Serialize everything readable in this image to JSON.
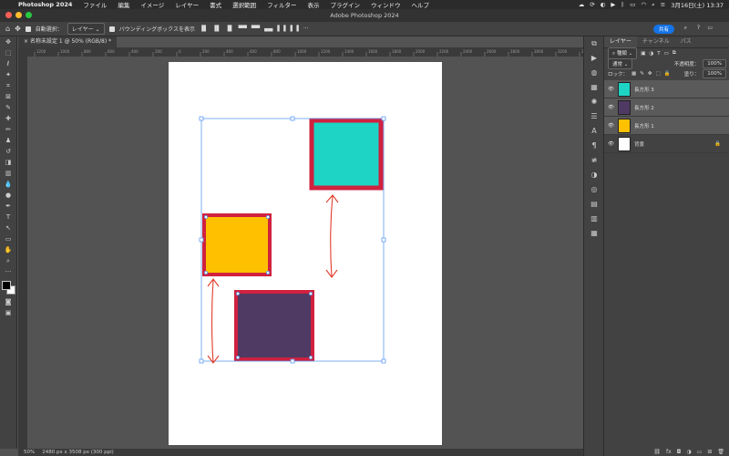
{
  "menubar": {
    "app": "Photoshop 2024",
    "items": [
      "ファイル",
      "編集",
      "イメージ",
      "レイヤー",
      "書式",
      "選択範囲",
      "フィルター",
      "表示",
      "プラグイン",
      "ウィンドウ",
      "ヘルプ"
    ],
    "datetime": "3月16日(土) 13:37"
  },
  "window": {
    "title": "Adobe Photoshop 2024"
  },
  "options": {
    "auto_select_label": "自動選択：",
    "auto_select_value": "レイヤー",
    "bbox_label": "バウンディングボックスを表示",
    "share_label": "共有"
  },
  "document": {
    "tab_title": "名称未設定 1 @ 50% (RGB/8) *",
    "zoom": "50%",
    "info": "2480 px x 3508 px (300 ppi)"
  },
  "ruler_ticks": [
    "1200",
    "1000",
    "800",
    "600",
    "400",
    "200",
    "0",
    "200",
    "400",
    "600",
    "800",
    "1000",
    "1200",
    "1400",
    "1600",
    "1800",
    "2000",
    "2200",
    "2400",
    "2600",
    "2800",
    "3000",
    "3200",
    "3400"
  ],
  "layers_panel": {
    "tabs": [
      "レイヤー",
      "チャンネル",
      "パス"
    ],
    "filter_label": "種類",
    "blend_mode": "通常",
    "opacity_label": "不透明度：",
    "opacity_value": "100%",
    "lock_label": "ロック：",
    "fill_label": "塗り：",
    "fill_value": "100%",
    "layers": [
      {
        "name": "長方形 3",
        "color": "#1ed4c4"
      },
      {
        "name": "長方形 2",
        "color": "#4f3a63"
      },
      {
        "name": "長方形 1",
        "color": "#ffc000"
      },
      {
        "name": "背景",
        "color": "#ffffff"
      }
    ]
  },
  "colors": {
    "teal": "#1ed4c4",
    "yellow": "#ffc000",
    "purple": "#4f3a63",
    "border_red": "#d0213f",
    "arrow_red": "#e23b2a",
    "selection_blue": "#5e9cf2"
  }
}
